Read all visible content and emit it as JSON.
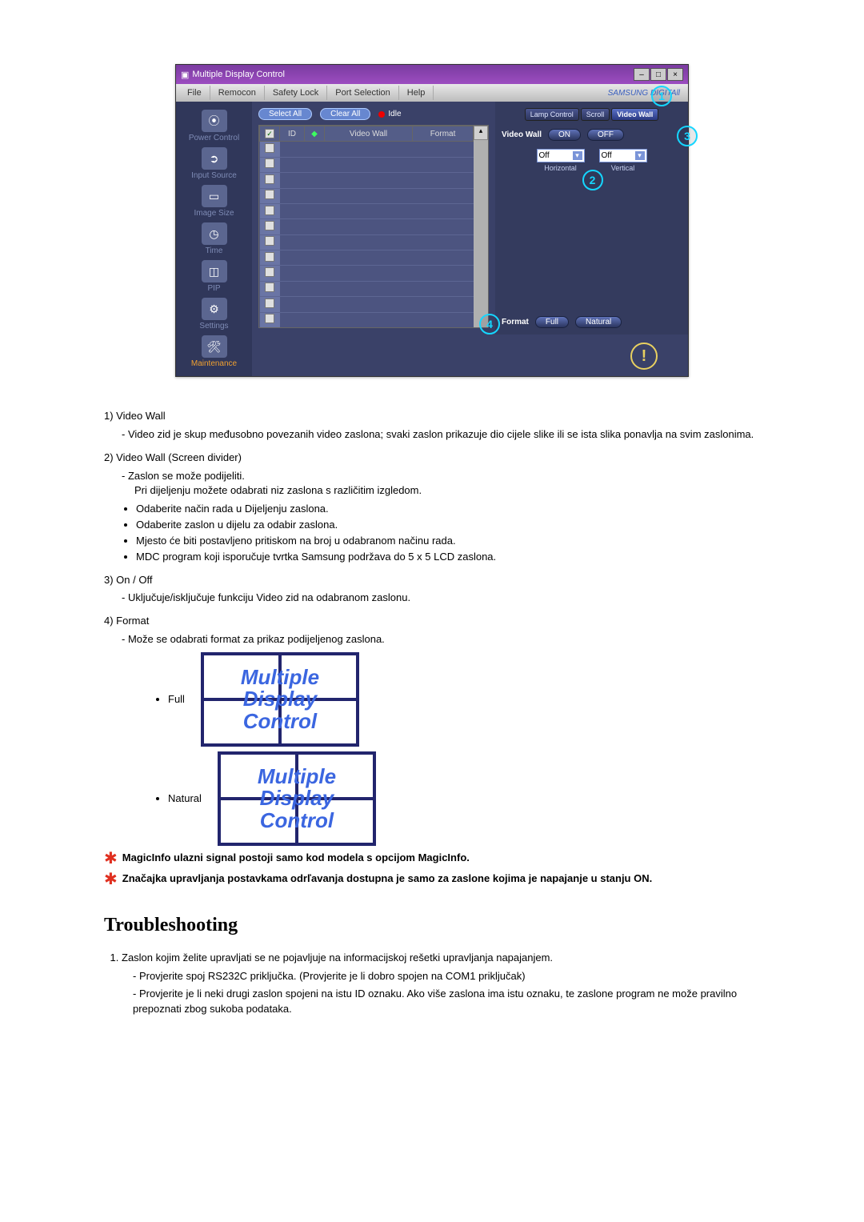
{
  "window": {
    "title": "Multiple Display Control",
    "menu": {
      "file": "File",
      "remocon": "Remocon",
      "safety": "Safety Lock",
      "port": "Port Selection",
      "help": "Help"
    },
    "brand": "SAMSUNG DIGITAll"
  },
  "sidebar": {
    "power": "Power Control",
    "input": "Input Source",
    "image": "Image Size",
    "time": "Time",
    "pip": "PIP",
    "settings": "Settings",
    "maintenance": "Maintenance"
  },
  "toolbar": {
    "selectAll": "Select All",
    "clearAll": "Clear All",
    "idle": "Idle"
  },
  "grid": {
    "col_id": "ID",
    "col_vw": "Video Wall",
    "col_fmt": "Format"
  },
  "tabs": {
    "lamp": "Lamp Control",
    "scroll": "Scroll",
    "video": "Video Wall"
  },
  "panel": {
    "videoWallLabel": "Video Wall",
    "on": "ON",
    "off": "OFF",
    "horiz": "Horizontal",
    "vert": "Vertical",
    "opt_off": "Off",
    "formatLabel": "Format",
    "full": "Full",
    "natural": "Natural"
  },
  "circles": {
    "c1": "1",
    "c2": "2",
    "c3": "3",
    "c4": "4"
  },
  "doc": {
    "i1title": "1) Video Wall",
    "i1text": "- Video zid je skup međusobno povezanih video zaslona; svaki zaslon prikazuje dio cijele slike ili se ista slika ponavlja na svim zaslonima.",
    "i2title": "2) Video Wall (Screen divider)",
    "i2l1": "- Zaslon se može podijeliti.",
    "i2l2": "Pri dijeljenju možete odabrati niz zaslona s različitim izgledom.",
    "i2b1": "Odaberite način rada u Dijeljenju zaslona.",
    "i2b2": "Odaberite zaslon u dijelu za odabir zaslona.",
    "i2b3": "Mjesto će biti postavljeno pritiskom na broj u odabranom načinu rada.",
    "i2b4": "MDC program koji isporučuje tvrtka Samsung podržava do 5 x 5 LCD zaslona.",
    "i3title": "3) On / Off",
    "i3text": "- Uključuje/isključuje funkciju Video zid na odabranom zaslonu.",
    "i4title": "4) Format",
    "i4text": "- Može se odabrati format za prikaz podijeljenog zaslona.",
    "fmt_full": "Full",
    "fmt_natural": "Natural",
    "mdc_text": "Multiple\nDisplay\nControl",
    "note1": "MagicInfo ulazni signal postoji samo kod modela s opcijom MagicInfo.",
    "note2": "Značajka upravljanja postavkama odrľavanja dostupna je samo za zaslone kojima je napajanje u stanju ON.",
    "tsHeading": "Troubleshooting",
    "ts1": "Zaslon kojim želite upravljati se ne pojavljuje na informacijskoj rešetki upravljanja napajanjem.",
    "ts1a": "- Provjerite spoj RS232C priključka. (Provjerite je li dobro spojen na COM1 priključak)",
    "ts1b": "- Provjerite je li neki drugi zaslon spojeni na istu ID oznaku. Ako više zaslona ima istu oznaku, te zaslone program ne može pravilno prepoznati zbog sukoba podataka."
  }
}
